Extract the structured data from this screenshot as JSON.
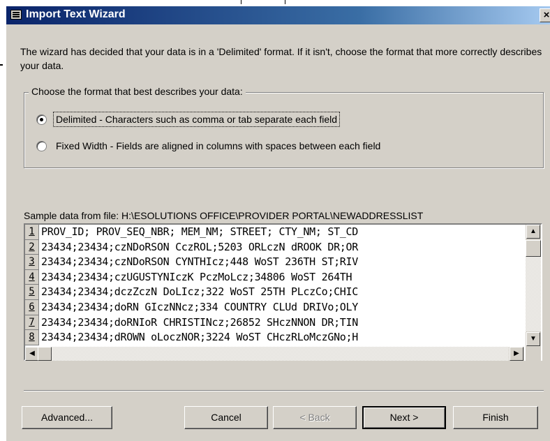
{
  "window": {
    "title": "Import Text Wizard",
    "close_label": "×"
  },
  "intro_text": "The wizard has decided that your data is in a 'Delimited' format.  If it isn't, choose the format that more correctly describes your data.",
  "format_group": {
    "legend": "Choose the format that best describes your data:",
    "options": [
      {
        "label": "Delimited - Characters such as comma or tab separate each field",
        "checked": true
      },
      {
        "label": "Fixed Width - Fields are aligned in columns with spaces between each field",
        "checked": false
      }
    ]
  },
  "sample": {
    "label": "Sample data from file: H:\\ESOLUTIONS OFFICE\\PROVIDER PORTAL\\NEWADDRESSLIST",
    "rows": [
      {
        "num": "1",
        "text": "PROV_ID; PROV_SEQ_NBR; MEM_NM; STREET; CTY_NM; ST_CD"
      },
      {
        "num": "2",
        "text": "23434;23434;czNDoRSON CczROL;5203 ORLczN dROOK DR;OR"
      },
      {
        "num": "3",
        "text": "23434;23434;czNDoRSON CYNTHIcz;448 WoST 236TH ST;RIV"
      },
      {
        "num": "4",
        "text": "23434;23434;czUGUSTYNIczK PczMoLcz;34806 WoST 264TH"
      },
      {
        "num": "5",
        "text": "23434;23434;dczZczN DoLIcz;322 WoST 25TH PLczCo;CHIC"
      },
      {
        "num": "6",
        "text": "23434;23434;doRN GIczNNcz;334 COUNTRY CLUd DRIVo;OLY"
      },
      {
        "num": "7",
        "text": "23434;23434;doRNIoR CHRISTINcz;26852 SHczNNON DR;TIN"
      },
      {
        "num": "8",
        "text": "23434;23434;dROWN oLoczNOR;3224 WoST CHczRLoMczGNo;H"
      }
    ]
  },
  "buttons": {
    "advanced": "Advanced...",
    "cancel": "Cancel",
    "back": "< Back",
    "next": "Next >",
    "finish": "Finish"
  }
}
